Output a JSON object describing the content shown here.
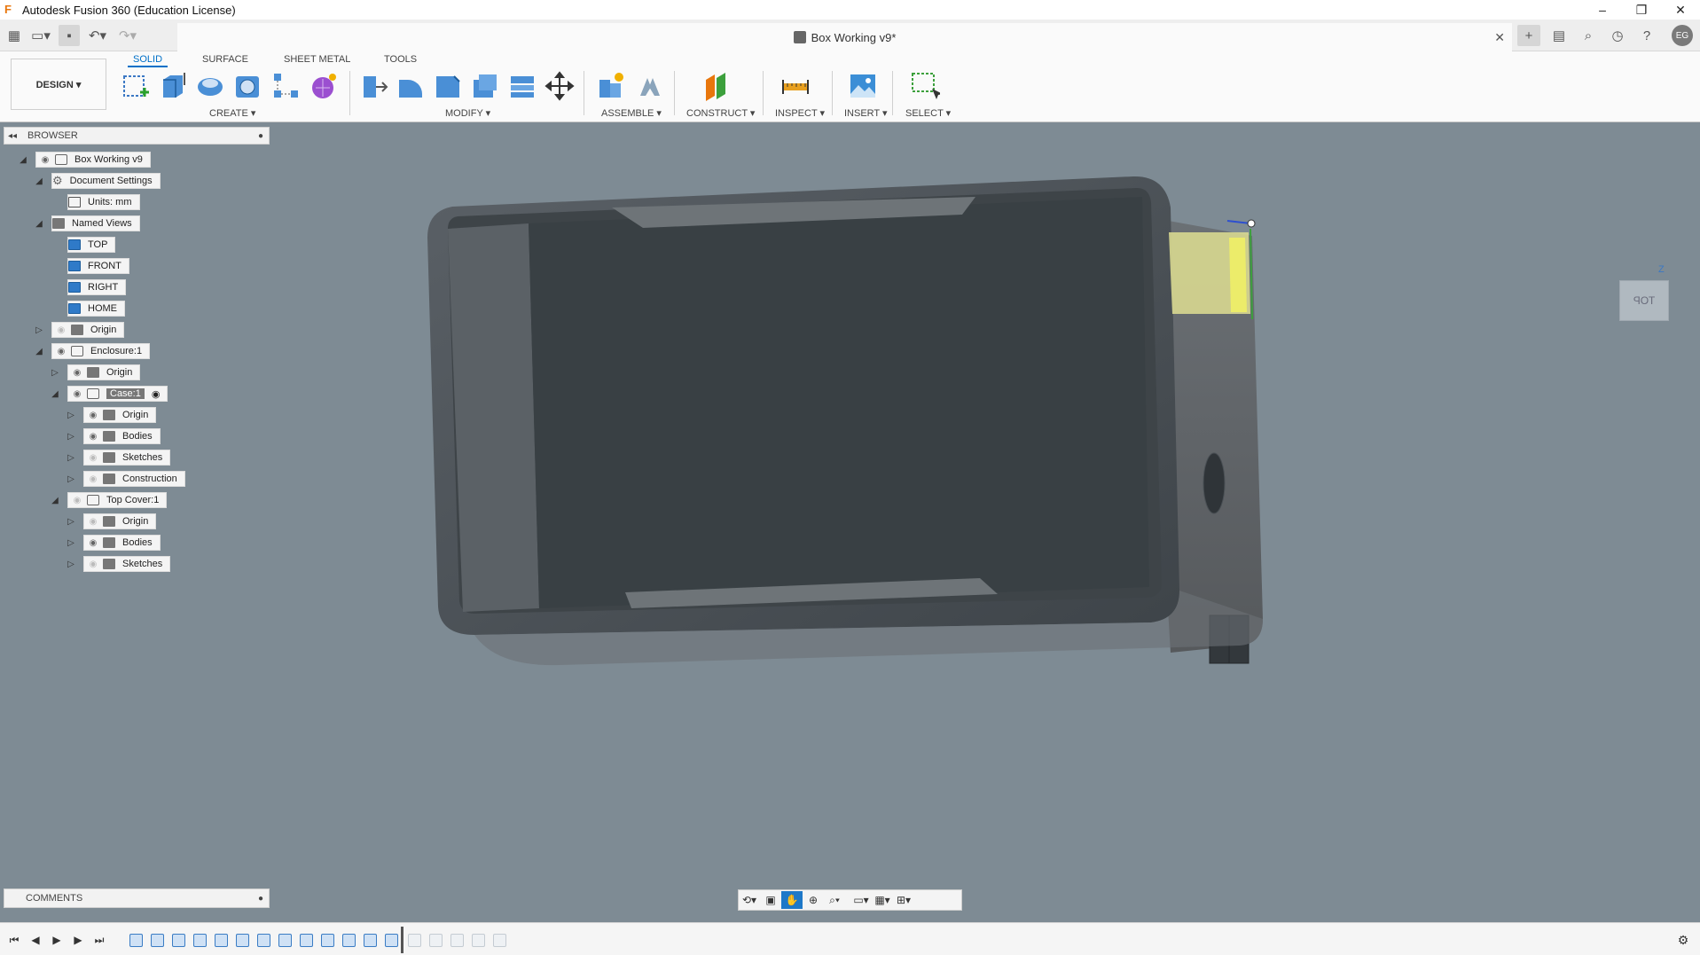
{
  "window": {
    "title": "Autodesk Fusion 360 (Education License)",
    "controls": [
      "–",
      "❐",
      "✕"
    ]
  },
  "document_tab": {
    "title": "Box Working v9*"
  },
  "user": {
    "initials": "EG"
  },
  "workspace": {
    "mode_label": "DESIGN ▾",
    "tabs": [
      "SOLID",
      "SURFACE",
      "SHEET METAL",
      "TOOLS"
    ],
    "active_tab": "SOLID"
  },
  "toolbar_groups": {
    "create": "CREATE ▾",
    "modify": "MODIFY ▾",
    "assemble": "ASSEMBLE ▾",
    "construct": "CONSTRUCT ▾",
    "inspect": "INSPECT ▾",
    "insert": "INSERT ▾",
    "select": "SELECT ▾"
  },
  "browser": {
    "header": "BROWSER",
    "nodes": [
      {
        "label": "Box Working v9"
      },
      {
        "label": "Document Settings"
      },
      {
        "label": "Units: mm"
      },
      {
        "label": "Named Views"
      },
      {
        "label": "TOP"
      },
      {
        "label": "FRONT"
      },
      {
        "label": "RIGHT"
      },
      {
        "label": "HOME"
      },
      {
        "label": "Origin"
      },
      {
        "label": "Enclosure:1"
      },
      {
        "label": "Origin"
      },
      {
        "label": "Case:1"
      },
      {
        "label": "Origin"
      },
      {
        "label": "Bodies"
      },
      {
        "label": "Sketches"
      },
      {
        "label": "Construction"
      },
      {
        "label": "Top Cover:1"
      },
      {
        "label": "Origin"
      },
      {
        "label": "Bodies"
      },
      {
        "label": "Sketches"
      }
    ]
  },
  "viewcube": {
    "face_label": "TOP",
    "axis_label": "Z"
  },
  "comments": {
    "header": "COMMENTS"
  },
  "colors": {
    "accent": "#0070c8",
    "viewport_bg": "#7e8b94",
    "model_body": "#3c4348",
    "highlight_face": "#d8d890"
  }
}
